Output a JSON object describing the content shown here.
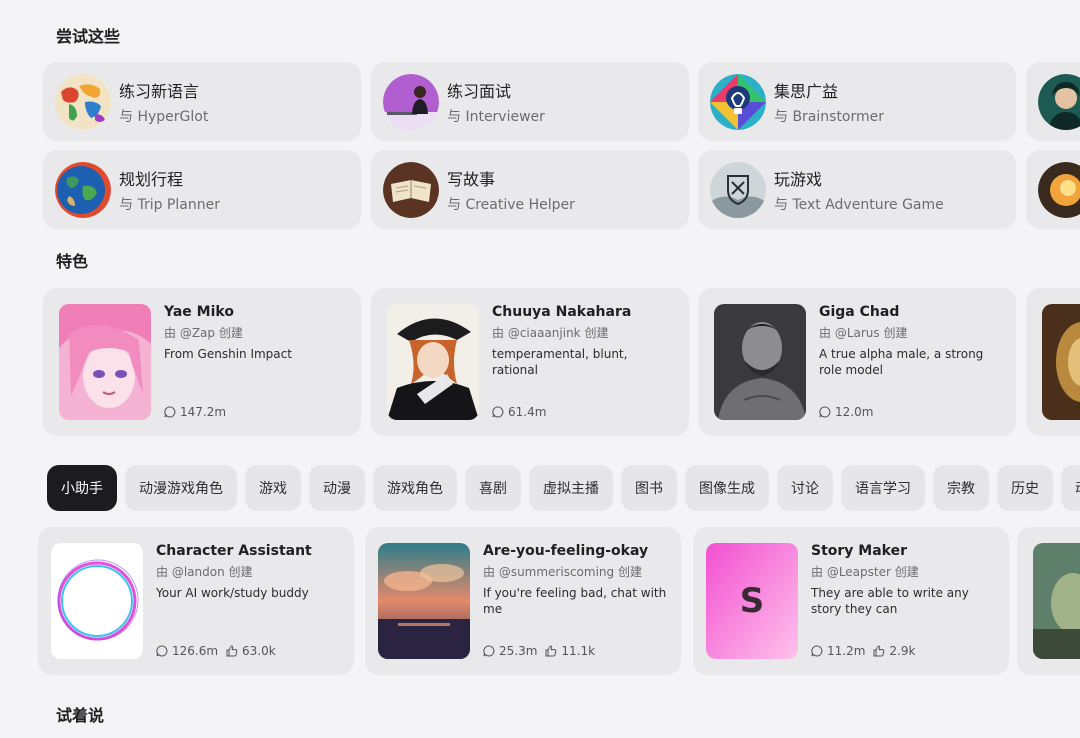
{
  "sections": {
    "try_title": "尝试这些",
    "featured_title": "特色",
    "say_title": "试着说"
  },
  "try_cards": [
    {
      "title": "练习新语言",
      "sub": "与 HyperGlot",
      "icon": "world-map-icon"
    },
    {
      "title": "练习面试",
      "sub": "与 Interviewer",
      "icon": "interviewer-icon"
    },
    {
      "title": "集思广益",
      "sub": "与 Brainstormer",
      "icon": "lightbulb-icon"
    },
    {
      "title": "规划行程",
      "sub": "与 Trip Planner",
      "icon": "globe-icon"
    },
    {
      "title": "写故事",
      "sub": "与 Creative Helper",
      "icon": "book-icon"
    },
    {
      "title": "玩游戏",
      "sub": "与 Text Adventure Game",
      "icon": "shield-icon"
    }
  ],
  "featured": [
    {
      "name": "Yae Miko",
      "by": "由 @Zap 创建",
      "desc": "From Genshin Impact",
      "chats": "147.2m"
    },
    {
      "name": "Chuuya Nakahara",
      "by": "由 @ciaaanjink 创建",
      "desc": "temperamental, blunt, rational",
      "chats": "61.4m"
    },
    {
      "name": "Giga Chad",
      "by": "由 @Larus 创建",
      "desc": "A true alpha male, a strong role model",
      "chats": "12.0m"
    }
  ],
  "categories": [
    "小助手",
    "动漫游戏角色",
    "游戏",
    "动漫",
    "游戏角色",
    "喜剧",
    "虚拟主播",
    "图书",
    "图像生成",
    "讨论",
    "语言学习",
    "宗教",
    "历史",
    "动物"
  ],
  "assistants": [
    {
      "name": "Character Assistant",
      "by": "由 @landon 创建",
      "desc": "Your AI work/study buddy",
      "chats": "126.6m",
      "likes": "63.0k"
    },
    {
      "name": "Are-you-feeling-okay",
      "by": "由 @summeriscoming 创建",
      "desc": "If you're feeling bad, chat with me",
      "chats": "25.3m",
      "likes": "11.1k"
    },
    {
      "name": "Story Maker",
      "by": "由 @Leapster 创建",
      "desc": "They are able to write any story they can",
      "chats": "11.2m",
      "likes": "2.9k",
      "avatar_letter": "S"
    }
  ],
  "colors": {
    "active_tab": "#1c1c20",
    "card": "#e9e9ec",
    "background": "#f4f4f6"
  }
}
